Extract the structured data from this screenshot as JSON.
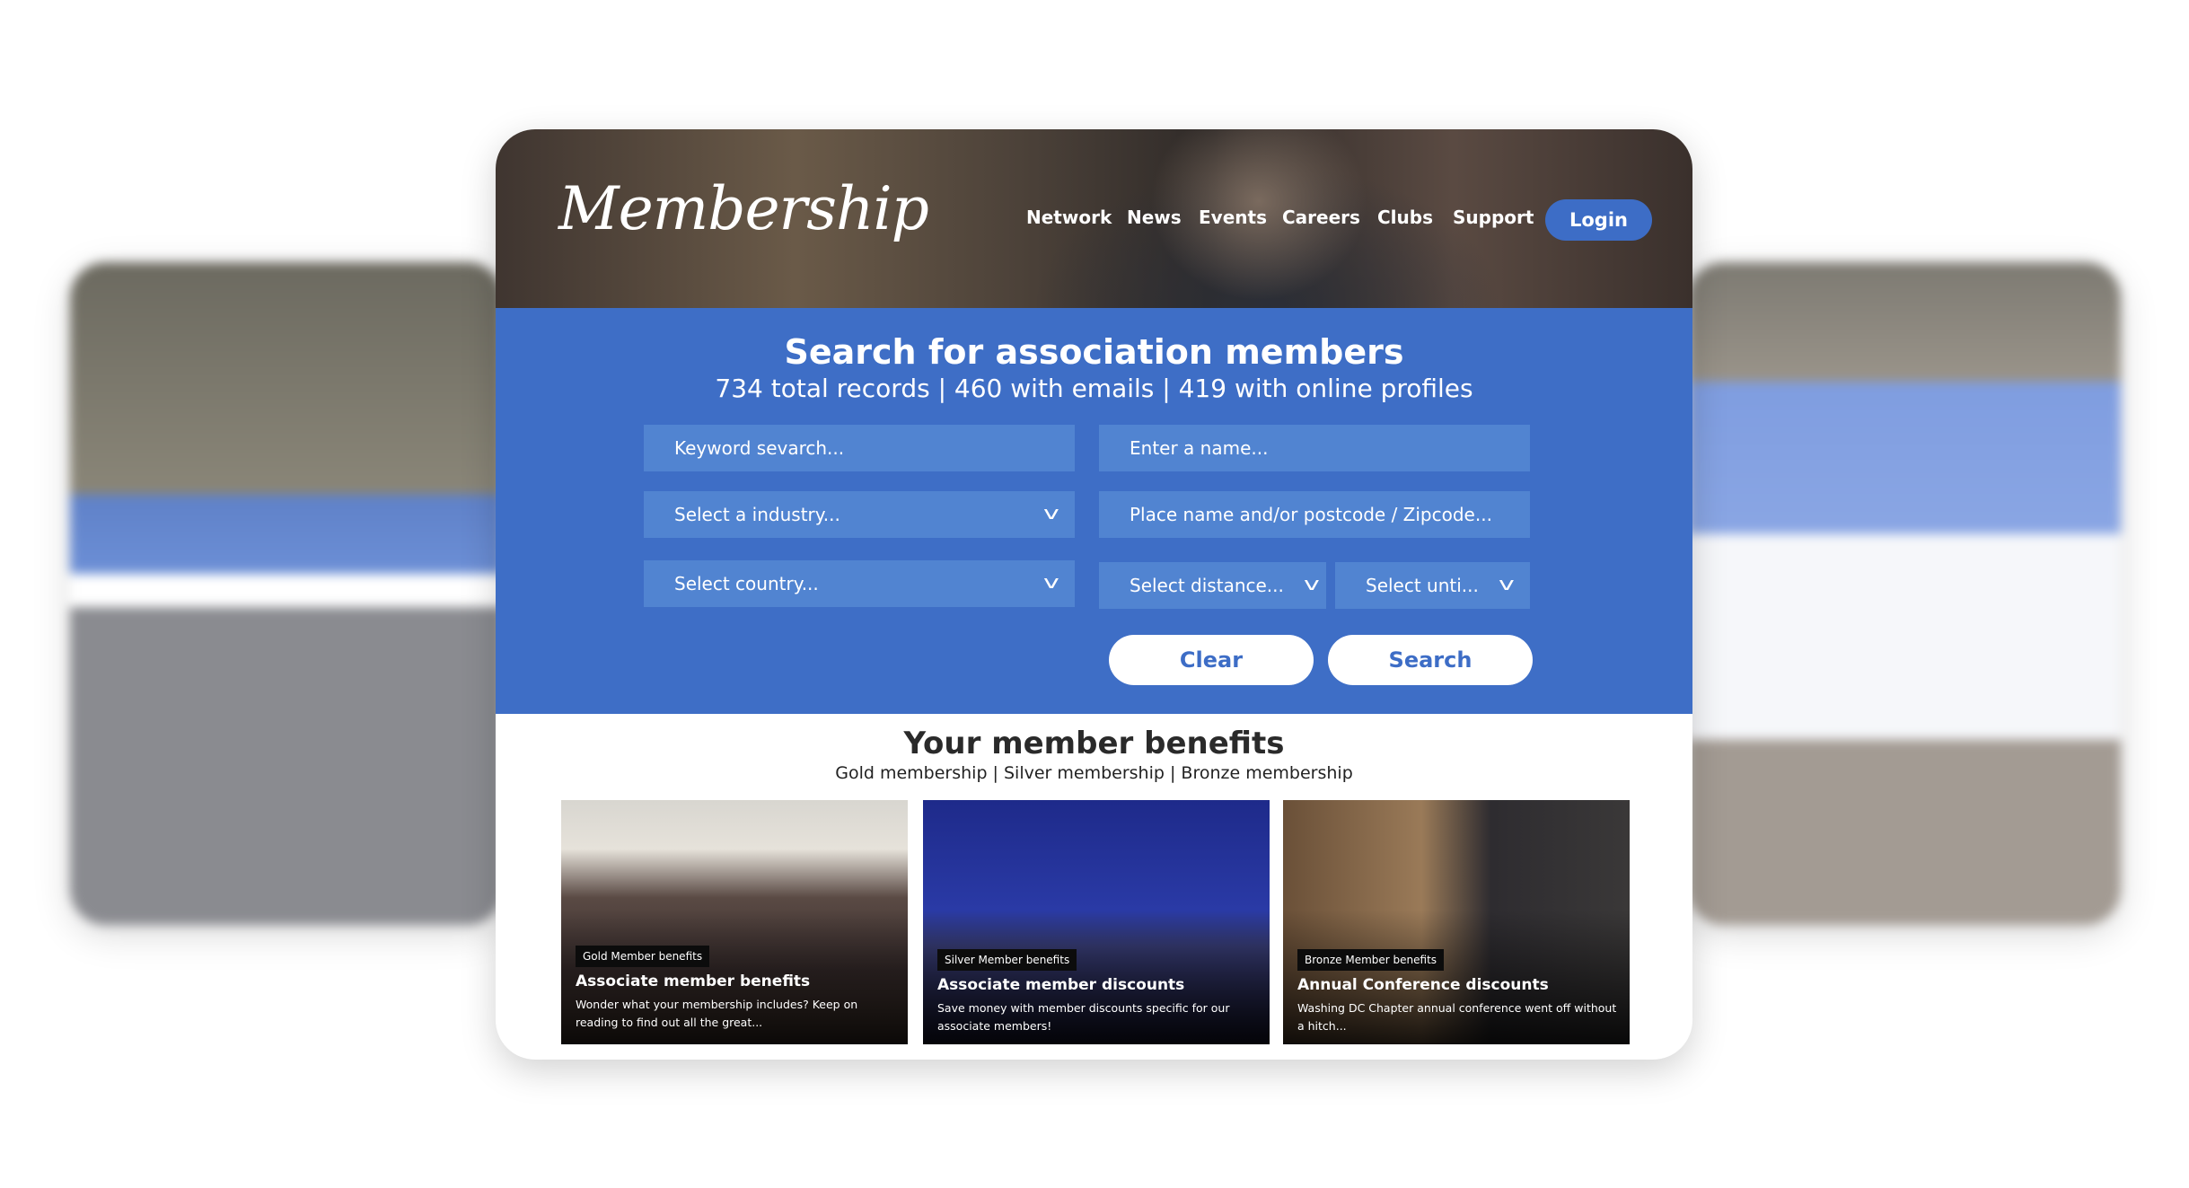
{
  "brand": {
    "logo": "Membership"
  },
  "nav": {
    "items": [
      "Network",
      "News",
      "Events",
      "Careers",
      "Clubs",
      "Support"
    ],
    "login": "Login"
  },
  "search": {
    "title": "Search for association members",
    "stats": "734 total records | 460 with emails | 419 with online profiles",
    "keyword_placeholder": "Keyword sevarch...",
    "name_placeholder": "Enter a name...",
    "industry": "Select a industry...",
    "place_placeholder": "Place name and/or postcode / Zipcode...",
    "country": "Select country...",
    "distance": "Select distance...",
    "unit": "Select unti...",
    "clear": "Clear",
    "search": "Search",
    "accent": "#3e6ec6"
  },
  "benefits": {
    "title": "Your member benefits",
    "subtitle": "Gold membership | Silver membership | Bronze membership",
    "cards": [
      {
        "badge": "Gold Member benefits",
        "title": "Associate  member benefits",
        "desc": "Wonder what your membership includes? Keep on reading to find out all the great..."
      },
      {
        "badge": "Silver Member benefits",
        "title": "Associate  member discounts",
        "desc": "Save money with member discounts specific for our associate members!"
      },
      {
        "badge": "Bronze Member benefits",
        "title": "Annual Conference discounts",
        "desc": "Washing DC Chapter annual conference went off without a hitch..."
      }
    ]
  }
}
